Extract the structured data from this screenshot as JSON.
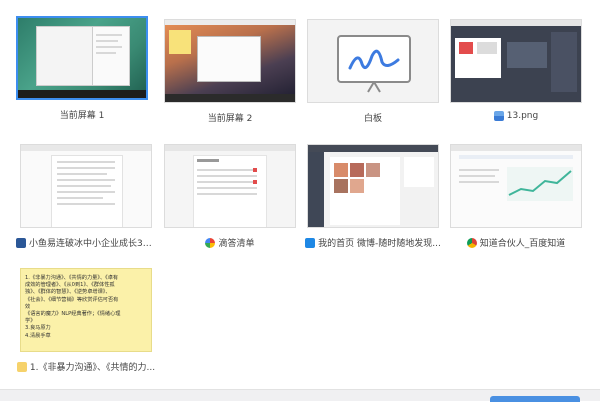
{
  "items": [
    {
      "label": "当前屏幕 1",
      "icon": "",
      "selected": true
    },
    {
      "label": "当前屏幕 2",
      "icon": ""
    },
    {
      "label": "白板",
      "icon": ""
    },
    {
      "label": "13.png",
      "icon": "image-file-icon"
    },
    {
      "label": "小鱼易连破冰中小企业成长3大...",
      "icon": "word-document-icon"
    },
    {
      "label": "滴答清单",
      "icon": "google-icon"
    },
    {
      "label": "我的首页 微博-随时随地发现...",
      "icon": "weibo-icon"
    },
    {
      "label": "知道合伙人_百度知道",
      "icon": "chrome-icon"
    },
    {
      "label": "1.《非暴力沟通》、《共情的力...",
      "icon": "sticky-note-icon"
    }
  ],
  "note_lines": [
    "1.《非暴力沟通》、《共情的力量》、《卓有",
    "成效的管理者》、《从0到1》、《群体性孤",
    "独》、《群体的智慧》、《逆势卓增课》、",
    "《社会》、《细节营销》等欣赏评估可否有",
    "效",
    "《语言的魔力》NLP经典著作；《情绪心理",
    "学》",
    "3.良马原力",
    "4.清晨手草"
  ],
  "colors": {
    "accent": "#3d8ef0",
    "note_bg": "#fbf1a9"
  }
}
